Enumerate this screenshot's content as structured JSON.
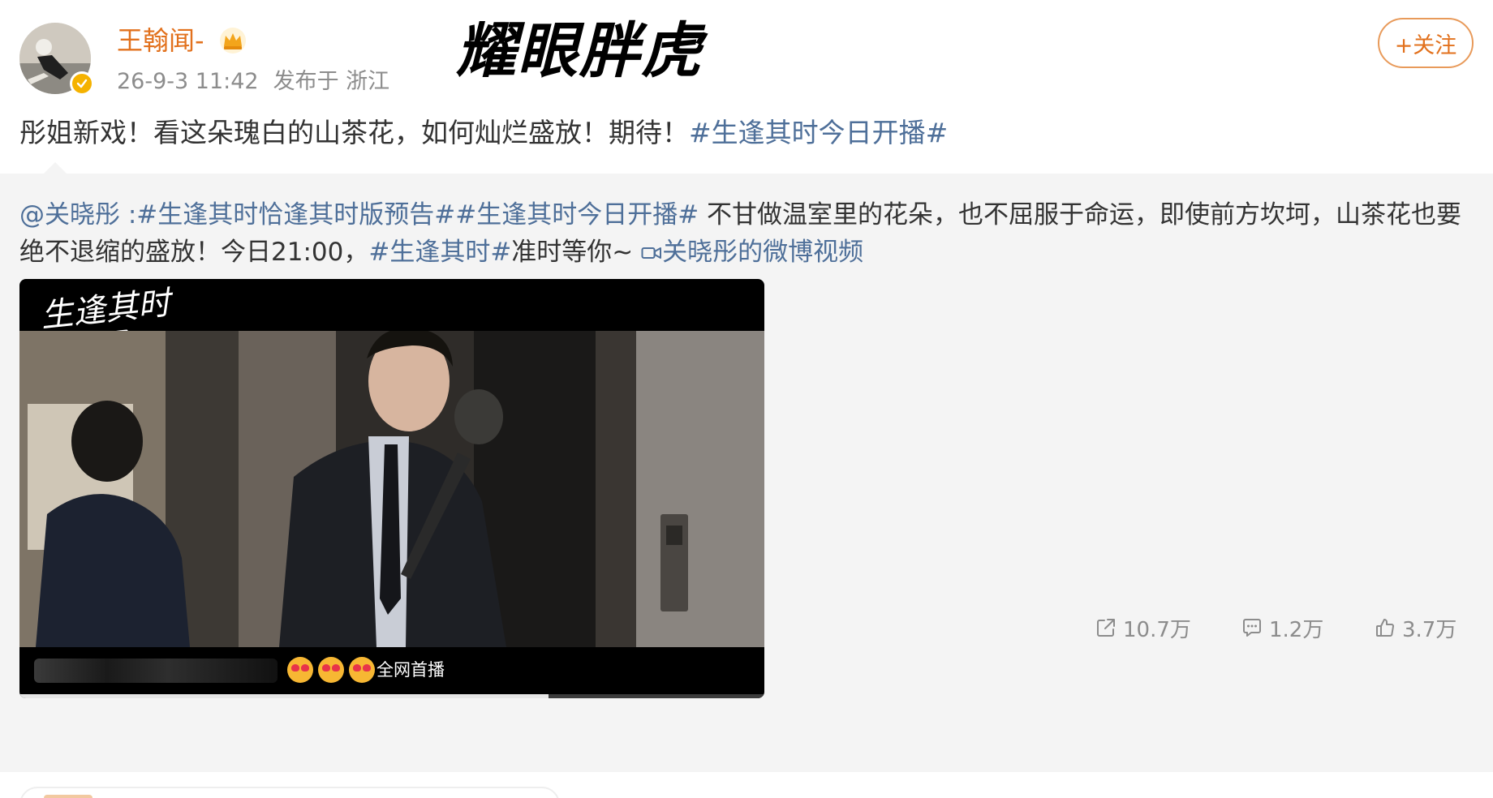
{
  "post": {
    "author": "王翰闻-",
    "date": "26-9-3 11:42",
    "location": "发布于 浙江",
    "follow_label": "+关注",
    "watermark": "耀眼胖虎",
    "text_plain": "彤姐新戏！看这朵瑰白的山茶花，如何灿烂盛放！期待！",
    "text_hashtag": "#生逢其时今日开播#"
  },
  "repost": {
    "mention": "@关晓彤 ",
    "hashtags": ":#生逢其时恰逢其时版预告##生逢其时今日开播#",
    "body1": " 不甘做温室里的花朵，也不屈服于命运，即使前方坎坷，山茶花也要绝不退缩的盛放！今日21:00，",
    "hashtag2": "#生逢其时#",
    "body2": "准时等你~ ",
    "video_link": "关晓彤的微博视频"
  },
  "video": {
    "logo": "生逢其时",
    "caption": "全网首播",
    "progress": 0.71
  },
  "actions": {
    "share_count": "10.7万",
    "comment_count": "1.2万",
    "like_count": "3.7万"
  },
  "colors": {
    "author": "#e2711d",
    "link": "#4e6f99",
    "muted": "#8c8c8c",
    "repost_bg": "#f4f4f4"
  },
  "icons": [
    "crown-icon",
    "verified-icon",
    "video-camera-icon",
    "share-icon",
    "comment-icon",
    "like-icon"
  ]
}
